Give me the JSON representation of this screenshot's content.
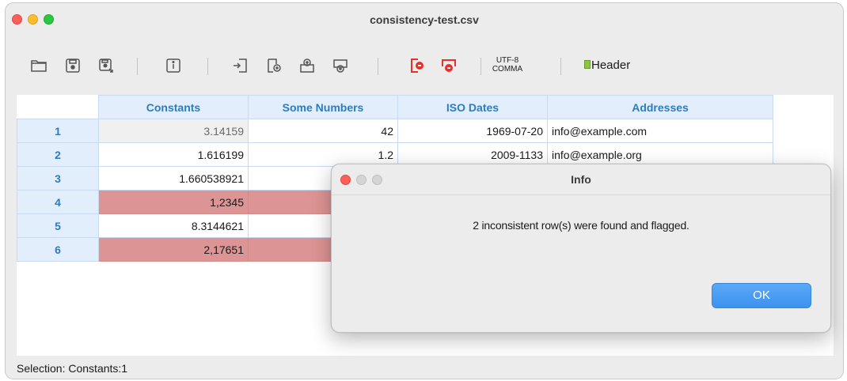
{
  "window": {
    "title": "consistency-test.csv"
  },
  "toolbar": {
    "icons": [
      "open-folder-icon",
      "save-icon",
      "save-as-icon",
      "info-icon",
      "insert-column-left-icon",
      "insert-row-below-icon",
      "insert-row-above-icon",
      "insert-row-icon",
      "delete-column-icon",
      "delete-row-icon"
    ],
    "encoding_line1": "UTF-8",
    "encoding_line2": "COMMA",
    "header_label": "Header"
  },
  "grid": {
    "columns": [
      "Constants",
      "Some Numbers",
      "ISO Dates",
      "Addresses"
    ],
    "rows": [
      {
        "num": "1",
        "cells": [
          "3.14159",
          "42",
          "1969-07-20",
          "info@example.com"
        ]
      },
      {
        "num": "2",
        "cells": [
          "1.616199",
          "1.2",
          "2009-1133",
          "info@example.org"
        ]
      },
      {
        "num": "3",
        "cells": [
          "1.660538921",
          "",
          "",
          ""
        ]
      },
      {
        "num": "4",
        "cells": [
          "1,2345",
          "",
          "",
          ""
        ]
      },
      {
        "num": "5",
        "cells": [
          "8.3144621",
          "",
          "",
          ""
        ]
      },
      {
        "num": "6",
        "cells": [
          "2,17651",
          "",
          "",
          ""
        ]
      }
    ]
  },
  "status": {
    "selection": "Selection: Constants:1"
  },
  "dialog": {
    "title": "Info",
    "message": "2 inconsistent row(s) were found and flagged.",
    "ok_label": "OK"
  },
  "colors": {
    "flagged_row": "#dd9494",
    "header_bg": "#e3eefc",
    "header_text": "#2e7bbd",
    "ok_button": "#4a9ff5",
    "delete_icons": "#e8302a"
  }
}
